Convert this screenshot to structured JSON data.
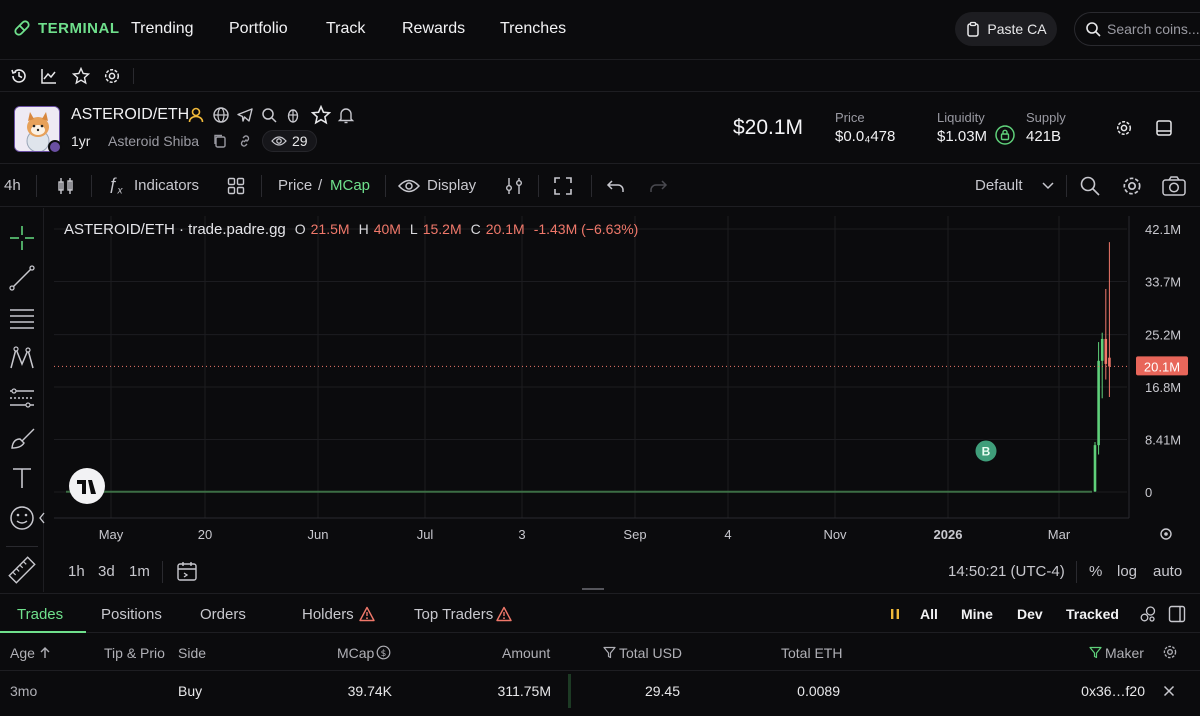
{
  "nav": {
    "logo": "TERMINAL",
    "items": [
      "Trending",
      "Portfolio",
      "Track",
      "Rewards",
      "Trenches"
    ],
    "paste_ca": "Paste CA",
    "search_placeholder": "Search coins..."
  },
  "token": {
    "pair": "ASTEROID/ETH",
    "age": "1yr",
    "name": "Asteroid Shiba",
    "watchers": "29",
    "mcap": "$20.1M",
    "price_label": "Price",
    "price_value": "$0.0₄478",
    "liquidity_label": "Liquidity",
    "liquidity_value": "$1.03M",
    "supply_label": "Supply",
    "supply_value": "421B"
  },
  "toolbar": {
    "interval": "4h",
    "indicators": "Indicators",
    "price": "Price",
    "slash": "/",
    "mcap": "MCap",
    "display": "Display",
    "layout": "Default"
  },
  "chart": {
    "source": "ASTEROID/ETH · trade.padre.gg",
    "o_label": "O",
    "o_value": "21.5M",
    "h_label": "H",
    "h_value": "40M",
    "l_label": "L",
    "l_value": "15.2M",
    "c_label": "C",
    "c_value": "20.1M",
    "change": "-1.43M (−6.63%)",
    "current_label": "20.1M",
    "buy_marker": "B",
    "colors": {
      "up": "#5fd07a",
      "down": "#f0786a",
      "grid": "#1c1c20"
    }
  },
  "chart_data": {
    "type": "line",
    "title": "ASTEROID/ETH · trade.padre.gg",
    "xlabel": "",
    "ylabel": "",
    "x_ticks": [
      "May",
      "20",
      "Jun",
      "Jul",
      "3",
      "Sep",
      "4",
      "Nov",
      "2026",
      "Mar"
    ],
    "y_ticks": [
      "42.1M",
      "33.7M",
      "25.2M",
      "16.8M",
      "8.41M",
      "0"
    ],
    "y_tick_values": [
      42.1,
      33.7,
      25.2,
      16.8,
      8.41,
      0
    ],
    "ylim": [
      0,
      42.1
    ],
    "current_value": 20.1,
    "series": [
      {
        "name": "",
        "x": [
          "May",
          "20",
          "Jun",
          "Jul",
          "3",
          "Sep",
          "4",
          "Nov",
          "2026",
          "Mar"
        ],
        "values": [
          0.04,
          0.04,
          0.04,
          0.04,
          0.04,
          0.04,
          0.04,
          0.04,
          0.04,
          0.04
        ]
      }
    ],
    "spike_candles": [
      {
        "o": 0.1,
        "h": 8.0,
        "l": 0.0,
        "c": 7.5
      },
      {
        "o": 7.5,
        "h": 24.0,
        "l": 6.0,
        "c": 21.0
      },
      {
        "o": 21.0,
        "h": 25.5,
        "l": 15.0,
        "c": 24.5
      },
      {
        "o": 24.5,
        "h": 32.5,
        "l": 18.0,
        "c": 20.5
      },
      {
        "o": 21.5,
        "h": 40.0,
        "l": 15.2,
        "c": 20.1
      }
    ]
  },
  "timebar": {
    "ranges": [
      "1h",
      "3d",
      "1m"
    ],
    "time": "14:50:21 (UTC-4)",
    "pct": "%",
    "log": "log",
    "auto": "auto"
  },
  "tabs": {
    "items": [
      "Trades",
      "Positions",
      "Orders",
      "Holders",
      "Top Traders"
    ],
    "filters": [
      "All",
      "Mine",
      "Dev",
      "Tracked"
    ]
  },
  "table": {
    "headers": {
      "age": "Age",
      "tip": "Tip & Prio",
      "side": "Side",
      "mcap": "MCap",
      "amount": "Amount",
      "total_usd": "Total USD",
      "total_eth": "Total ETH",
      "maker": "Maker"
    },
    "rows": [
      {
        "age": "3mo",
        "tip": "",
        "side": "Buy",
        "mcap": "39.74K",
        "amount": "311.75M",
        "total_usd": "29.45",
        "total_eth": "0.0089",
        "maker": "0x36…f20"
      }
    ]
  }
}
